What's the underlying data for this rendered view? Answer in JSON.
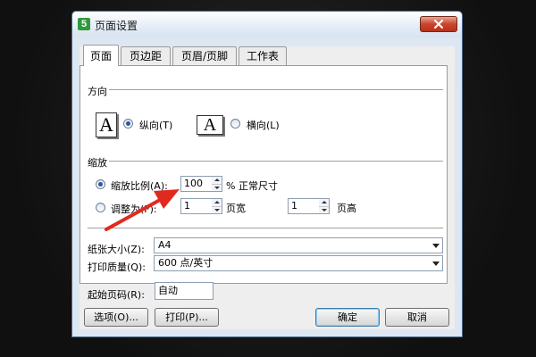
{
  "window": {
    "app_icon": "5",
    "title": "页面设置",
    "close": "close-icon"
  },
  "tabs": [
    {
      "label": "页面",
      "active": true
    },
    {
      "label": "页边距",
      "active": false
    },
    {
      "label": "页眉/页脚",
      "active": false
    },
    {
      "label": "工作表",
      "active": false
    }
  ],
  "orientation": {
    "section": "方向",
    "portrait_glyph": "A",
    "portrait_label": "纵向(T)",
    "landscape_glyph": "A",
    "landscape_label": "横向(L)",
    "selected": "portrait"
  },
  "scaling": {
    "section": "缩放",
    "scale_label": "缩放比例(A):",
    "scale_value": "100",
    "scale_suffix": "% 正常尺寸",
    "fit_label": "调整为(F):",
    "fit_wide_value": "1",
    "fit_wide_suffix": "页宽",
    "fit_tall_value": "1",
    "fit_tall_suffix": "页高",
    "selected": "scale"
  },
  "paper": {
    "label": "纸张大小(Z):",
    "value": "A4"
  },
  "quality": {
    "label": "打印质量(Q):",
    "value": "600 点/英寸"
  },
  "first_page": {
    "label": "起始页码(R):",
    "value": "自动"
  },
  "buttons": {
    "options": "选项(O)...",
    "print": "打印(P)...",
    "ok": "确定",
    "cancel": "取消"
  },
  "colors": {
    "annotation_arrow": "#e02a1f",
    "title_bar": "#dde7f2"
  }
}
